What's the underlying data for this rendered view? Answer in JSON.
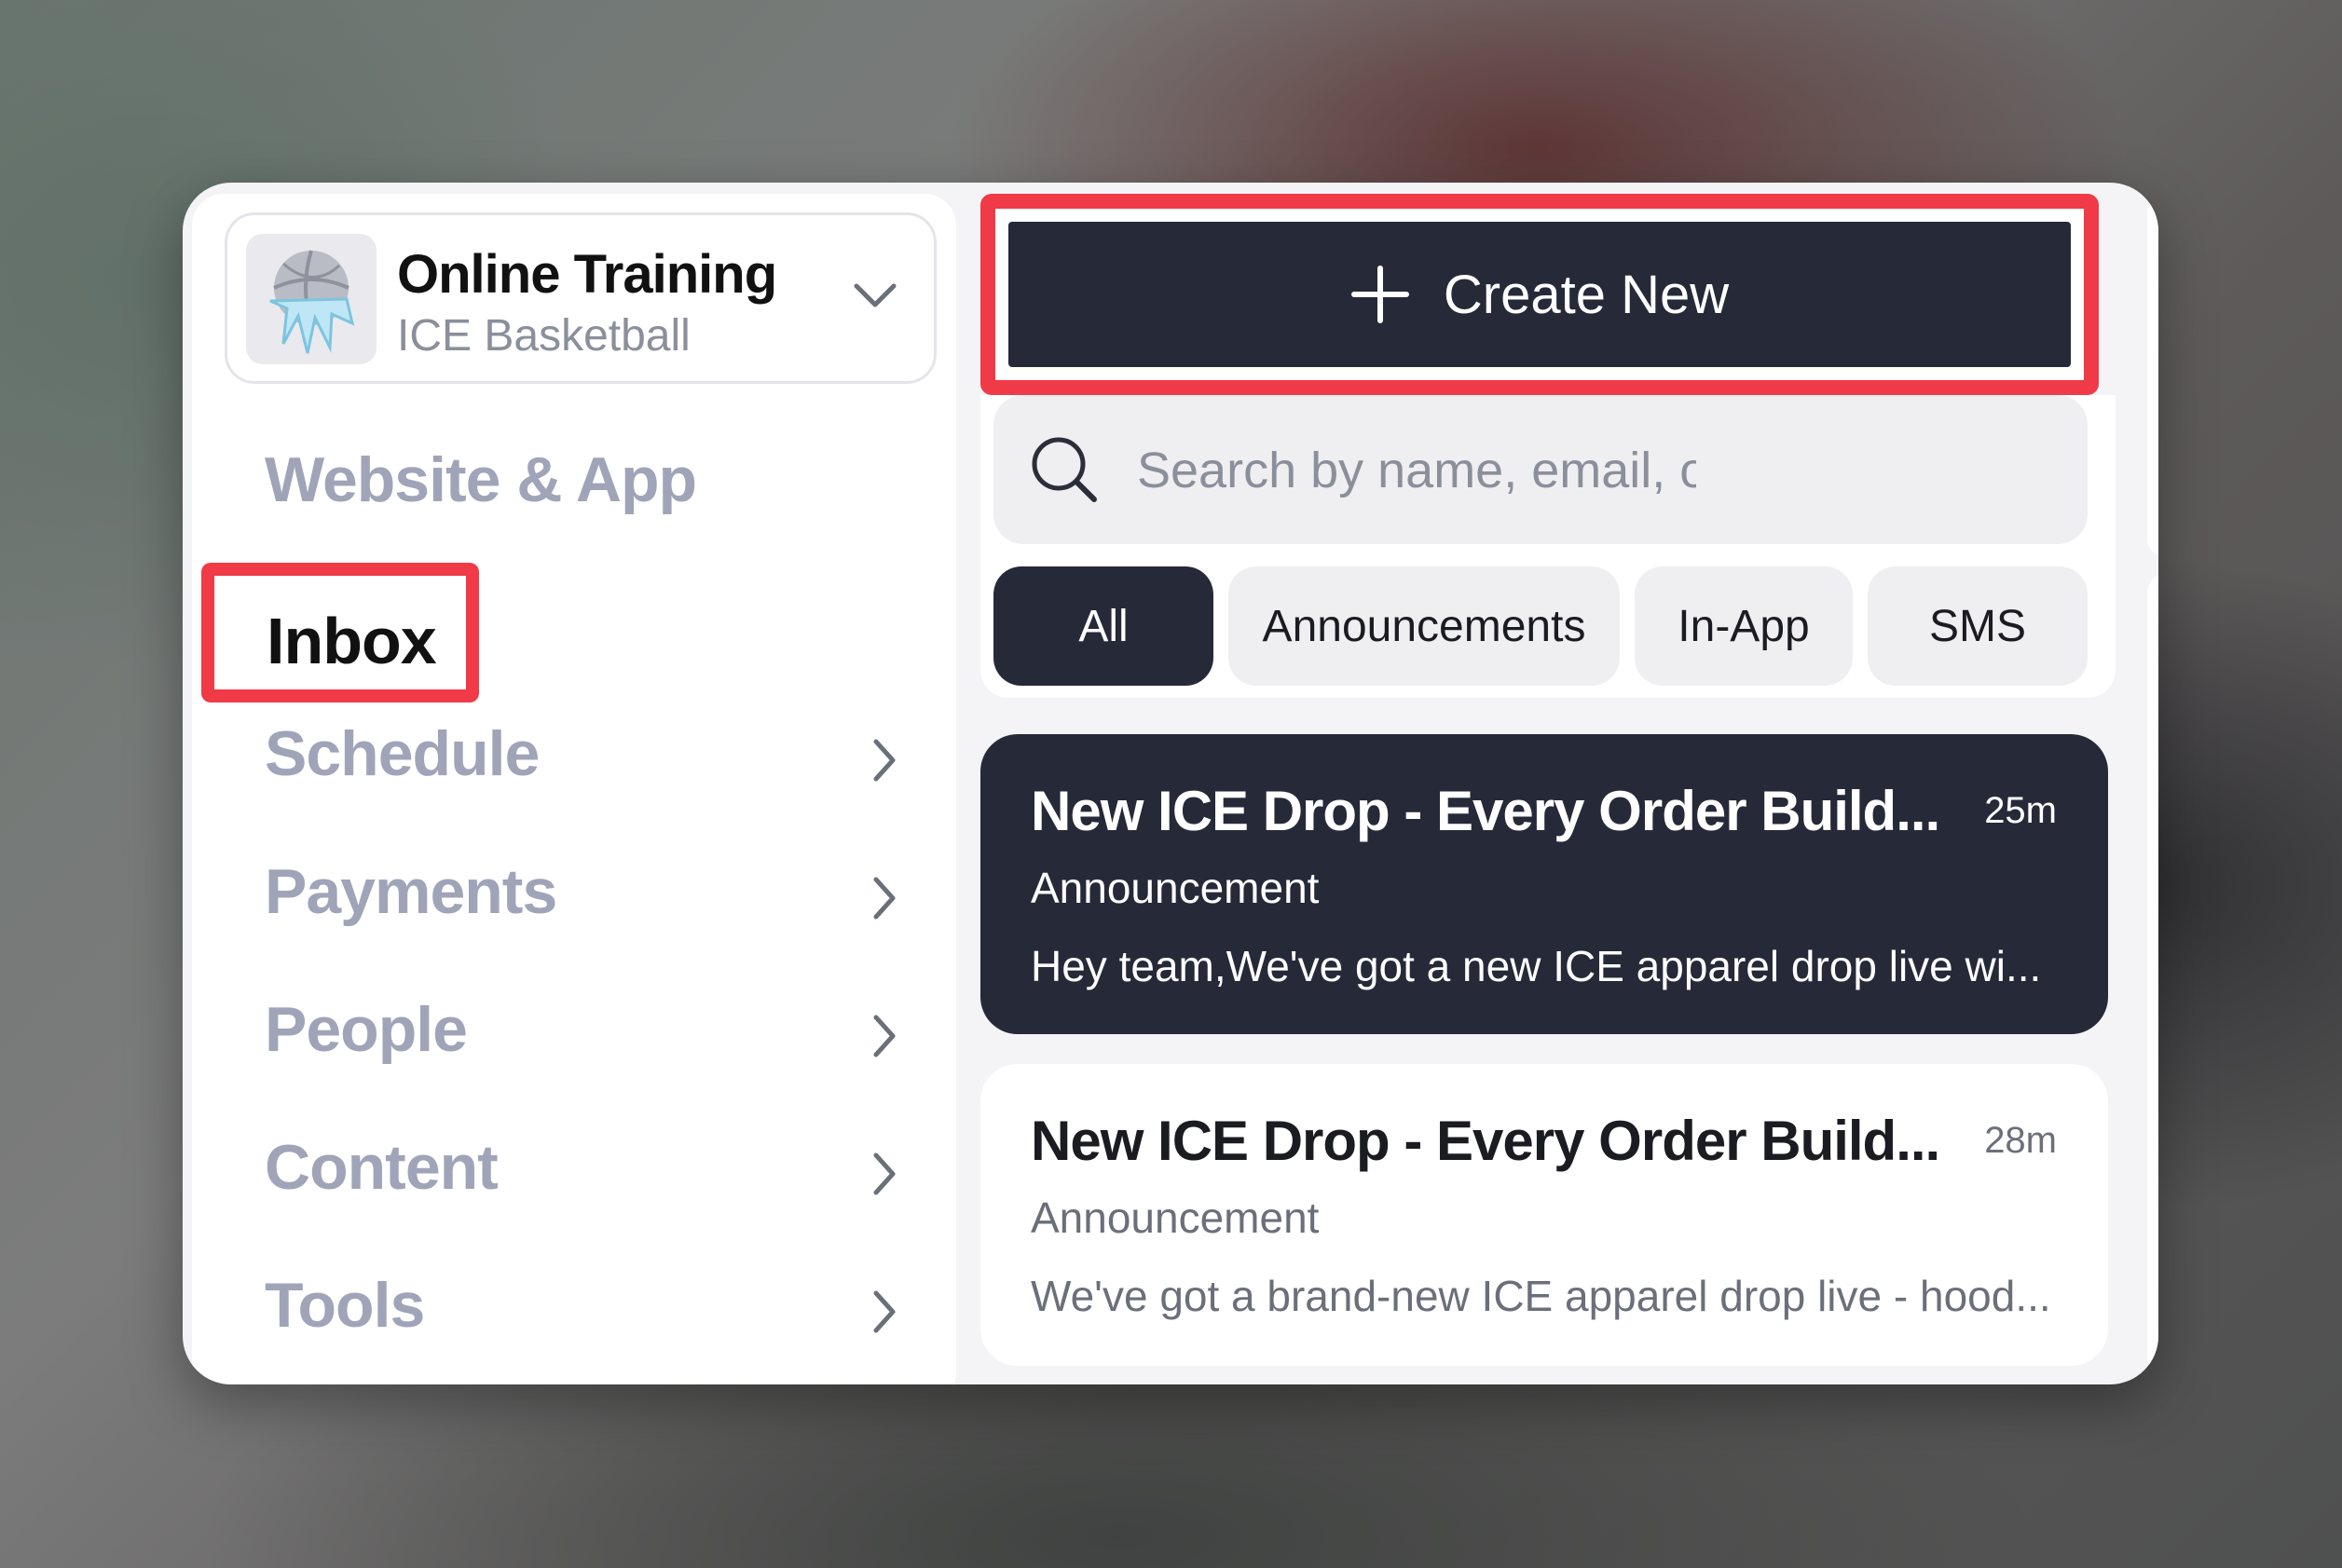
{
  "org": {
    "title": "Online Training",
    "subtitle": "ICE Basketball",
    "logo_icon": "basketball-ice-logo-icon",
    "dropdown_icon": "chevron-down-icon"
  },
  "nav": {
    "items": [
      {
        "label": "Website & App",
        "has_chevron": false
      },
      {
        "label": "Inbox",
        "active": true,
        "has_chevron": false
      },
      {
        "label": "Schedule",
        "has_chevron": true
      },
      {
        "label": "Payments",
        "has_chevron": true
      },
      {
        "label": "People",
        "has_chevron": true
      },
      {
        "label": "Content",
        "has_chevron": true
      },
      {
        "label": "Tools",
        "has_chevron": true
      }
    ]
  },
  "toolbar": {
    "create_label": "Create New",
    "create_icon": "plus-icon"
  },
  "search": {
    "placeholder": "Search by name, email, or",
    "value": "",
    "icon": "search-icon"
  },
  "filters": {
    "items": [
      {
        "label": "All",
        "active": true
      },
      {
        "label": "Announcements",
        "active": false
      },
      {
        "label": "In-App",
        "active": false
      },
      {
        "label": "SMS",
        "active": false
      }
    ]
  },
  "messages": [
    {
      "title": "New ICE Drop - Every Order Build...",
      "time": "25m",
      "type": "Announcement",
      "preview": "Hey team,We've got a new ICE apparel drop live wi...",
      "selected": true
    },
    {
      "title": "New ICE Drop - Every Order Build...",
      "time": "28m",
      "type": "Announcement",
      "preview": "We've got a brand-new ICE apparel drop live - hood...",
      "selected": false
    }
  ],
  "colors": {
    "highlight": "#f03a47",
    "dark": "#262938",
    "nav_muted": "#a0a4b8"
  }
}
